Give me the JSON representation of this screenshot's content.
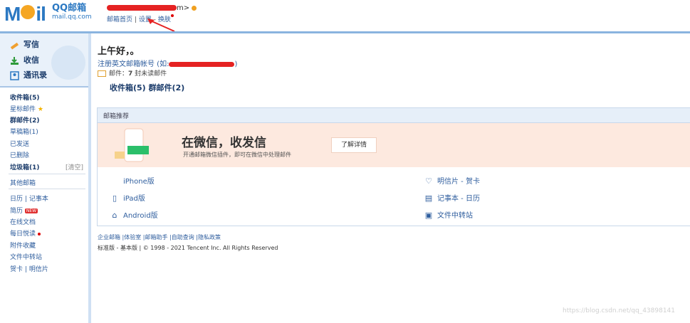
{
  "header": {
    "logo_word_left": "M",
    "logo_word_right": "il",
    "logo_product": "QQ邮箱",
    "logo_url": "mail.qq.com",
    "account_suffix": "m>",
    "links": {
      "home": "邮箱首页",
      "sep1": "|",
      "settings": "设置",
      "sep2": "-",
      "skin": "换肤"
    }
  },
  "sidebar": {
    "actions": [
      {
        "label": "写信",
        "icon": "pencil-icon"
      },
      {
        "label": "收信",
        "icon": "inbox-download-icon"
      },
      {
        "label": "通讯录",
        "icon": "contacts-icon"
      }
    ],
    "folders": {
      "inbox": "收件箱(5)",
      "starred": "星标邮件",
      "group": "群邮件(2)",
      "drafts": "草稿箱(1)",
      "sent": "已发送",
      "deleted": "已删除",
      "spam": "垃圾箱(1)",
      "spam_clear": "[清空]",
      "other": "其他邮箱"
    },
    "tools": {
      "calendar": "日历",
      "tools_sep": "|",
      "notebook": "记事本",
      "resume": "简历",
      "resume_badge": "NEW",
      "docs": "在线文档",
      "daily": "每日悦读",
      "attachments": "附件收藏",
      "transfer": "文件中转站",
      "cards": "贺卡",
      "cards_sep": "|",
      "postcards": "明信片"
    }
  },
  "main": {
    "greeting": "上午好，。",
    "register_label": "注册英文邮箱帐号 (如:",
    "register_end": ")",
    "mail_label": "邮件：",
    "mail_count": "7",
    "mail_unread": "封未读邮件",
    "inbox_count": "收件箱(5)",
    "group_count": "群邮件(2)"
  },
  "promo": {
    "header": "邮箱推荐",
    "banner_title": "在微信，收发信",
    "banner_sub": "开通邮箱微信插件，即可在微信中处理邮件",
    "banner_button": "了解详情",
    "links_left": [
      {
        "label": "iPhone版",
        "icon": "apple-icon"
      },
      {
        "label": "iPad版",
        "icon": "tablet-icon"
      },
      {
        "label": "Android版",
        "icon": "android-icon"
      }
    ],
    "links_right": [
      {
        "label": "明信片 - 贺卡",
        "icon": "heart-icon"
      },
      {
        "label": "记事本 - 日历",
        "icon": "calendar-icon"
      },
      {
        "label": "文件中转站",
        "icon": "file-transfer-icon"
      }
    ]
  },
  "footer": {
    "links": "企业邮箱 |体验室 |邮箱助手 |自助查询 |隐私政策",
    "copyright": "标准版 - 基本版 | © 1998 - 2021 Tencent Inc. All Rights Reserved"
  },
  "watermark": "https://blog.csdn.net/qq_43898141",
  "colors": {
    "accent": "#2b78c2",
    "banner_bg": "#fde9df",
    "link": "#2f5e9e",
    "redaction": "#e52222"
  }
}
